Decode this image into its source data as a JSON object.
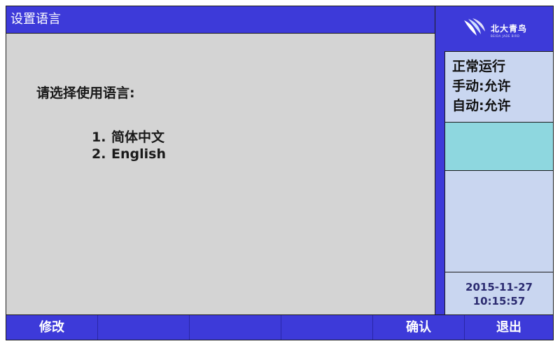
{
  "title": "设置语言",
  "prompt": "请选择使用语言:",
  "options": [
    {
      "number": "1.",
      "label": "简体中文"
    },
    {
      "number": "2.",
      "label": "English"
    }
  ],
  "logo": {
    "text": "北大青鸟",
    "subtext": "BEIDA JADE BIRD"
  },
  "status": {
    "line1": "正常运行",
    "line2": "手动:允许",
    "line3": "自动:允许"
  },
  "datetime": {
    "date": "2015-11-27",
    "time": "10:15:57"
  },
  "footer": {
    "btn1": "修改",
    "btn2": "",
    "btn3": "",
    "btn4": "",
    "btn5": "确认",
    "btn6": "退出"
  },
  "colors": {
    "primary": "#3d3ad9",
    "main_bg": "#d4d4d4",
    "panel_light": "#c9d6f0",
    "panel_cyan": "#8ed7df"
  },
  "icons": {
    "logo": "jade-bird-logo-icon"
  }
}
